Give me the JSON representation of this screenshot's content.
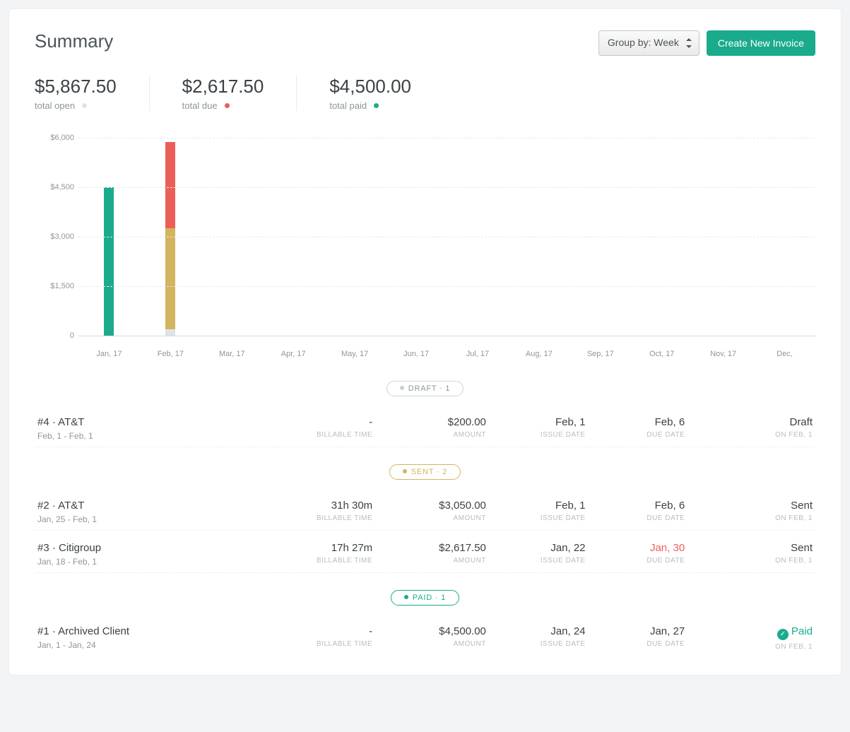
{
  "header": {
    "title": "Summary",
    "group_by_label": "Group by: Week",
    "create_invoice_label": "Create New Invoice"
  },
  "stats": {
    "open": {
      "value": "$5,867.50",
      "label": "total open"
    },
    "due": {
      "value": "$2,617.50",
      "label": "total due"
    },
    "paid": {
      "value": "$4,500.00",
      "label": "total paid"
    }
  },
  "chart_data": {
    "type": "bar",
    "stacked": true,
    "y_ticks": [
      "$6,000",
      "$4,500",
      "$3,000",
      "$1,500",
      "0"
    ],
    "y_values": [
      6000,
      4500,
      3000,
      1500,
      0
    ],
    "ylim": [
      0,
      6000
    ],
    "categories": [
      "Jan, 17",
      "Feb, 17",
      "Mar, 17",
      "Apr, 17",
      "May, 17",
      "Jun, 17",
      "Jul, 17",
      "Aug, 17",
      "Sep, 17",
      "Oct, 17",
      "Nov, 17",
      "Dec,"
    ],
    "series": [
      {
        "name": "paid",
        "color": "#1aab8c",
        "values": [
          4500,
          0,
          0,
          0,
          0,
          0,
          0,
          0,
          0,
          0,
          0,
          0
        ]
      },
      {
        "name": "draft",
        "color": "#e0e3e5",
        "values": [
          0,
          200,
          0,
          0,
          0,
          0,
          0,
          0,
          0,
          0,
          0,
          0
        ]
      },
      {
        "name": "sent",
        "color": "#d3b45f",
        "values": [
          0,
          3050,
          0,
          0,
          0,
          0,
          0,
          0,
          0,
          0,
          0,
          0
        ]
      },
      {
        "name": "due",
        "color": "#ec5f59",
        "values": [
          0,
          2617.5,
          0,
          0,
          0,
          0,
          0,
          0,
          0,
          0,
          0,
          0
        ]
      }
    ]
  },
  "groups": [
    {
      "key": "draft",
      "pill_class": "pill-draft",
      "dot_color": "#c7cfd3",
      "label": "DRAFT · 1",
      "rows": [
        {
          "title": "#4 · AT&T",
          "range": "Feb, 1 - Feb, 1",
          "billable": "-",
          "amount": "$200.00",
          "issue": "Feb, 1",
          "due": "Feb, 6",
          "due_red": false,
          "status": "Draft",
          "status_kind": "plain",
          "status_sub": "ON FEB, 1"
        }
      ]
    },
    {
      "key": "sent",
      "pill_class": "pill-sent",
      "dot_color": "#d3b45f",
      "label": "SENT · 2",
      "rows": [
        {
          "title": "#2 · AT&T",
          "range": "Jan, 25 - Feb, 1",
          "billable": "31h 30m",
          "amount": "$3,050.00",
          "issue": "Feb, 1",
          "due": "Feb, 6",
          "due_red": false,
          "status": "Sent",
          "status_kind": "plain",
          "status_sub": "ON FEB, 1"
        },
        {
          "title": "#3 · Citigroup",
          "range": "Jan, 18 - Feb, 1",
          "billable": "17h 27m",
          "amount": "$2,617.50",
          "issue": "Jan, 22",
          "due": "Jan, 30",
          "due_red": true,
          "status": "Sent",
          "status_kind": "plain",
          "status_sub": "ON FEB, 1"
        }
      ]
    },
    {
      "key": "paid",
      "pill_class": "pill-paid",
      "dot_color": "#1aab8c",
      "label": "PAID · 1",
      "rows": [
        {
          "title": "#1 · Archived Client",
          "range": "Jan, 1 - Jan, 24",
          "billable": "-",
          "amount": "$4,500.00",
          "issue": "Jan, 24",
          "due": "Jan, 27",
          "due_red": false,
          "status": "Paid",
          "status_kind": "paid",
          "status_sub": "ON FEB, 1"
        }
      ]
    }
  ],
  "col_labels": {
    "billable": "BILLABLE TIME",
    "amount": "AMOUNT",
    "issue": "ISSUE DATE",
    "due": "DUE DATE"
  }
}
